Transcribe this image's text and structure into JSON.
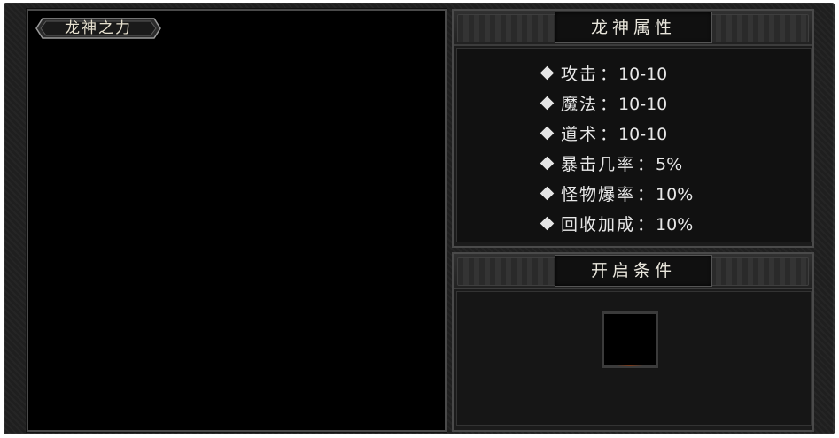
{
  "left_panel": {
    "title": "龙神之力"
  },
  "attributes_panel": {
    "title": "龙神属性",
    "items": [
      {
        "label": "攻击",
        "sep": "：",
        "value": "10-10"
      },
      {
        "label": "魔法",
        "sep": "：",
        "value": "10-10"
      },
      {
        "label": "道术",
        "sep": "：",
        "value": "10-10"
      },
      {
        "label": "暴击几率",
        "sep": "：",
        "value": "5%"
      },
      {
        "label": "怪物爆率",
        "sep": "：",
        "value": "10%"
      },
      {
        "label": "回收加成",
        "sep": "：",
        "value": "10%"
      }
    ]
  },
  "conditions_panel": {
    "title": "开启条件"
  },
  "colors": {
    "frame": "#202020",
    "text": "#e8e8e8",
    "panel_border": "#4a4a4a"
  }
}
